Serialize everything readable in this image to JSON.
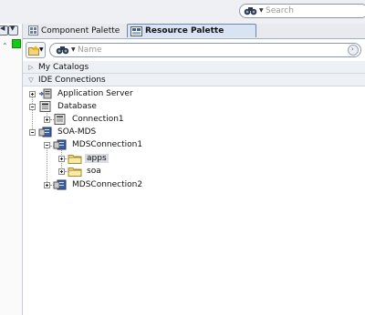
{
  "header": {
    "search_placeholder": "Search"
  },
  "tabs": [
    {
      "label": "Component Palette",
      "active": false
    },
    {
      "label": "Resource Palette",
      "active": true
    }
  ],
  "toolbar": {
    "name_placeholder": "Name"
  },
  "sections": {
    "my_catalogs": "My Catalogs",
    "ide_connections": "IDE Connections"
  },
  "tree": [
    {
      "label": "Application Server",
      "icon": "app-server-icon",
      "expanded": false
    },
    {
      "label": "Database",
      "icon": "database-icon",
      "expanded": true
    },
    {
      "label": "Connection1",
      "icon": "db-connection-icon",
      "expanded": false
    },
    {
      "label": "SOA-MDS",
      "icon": "mds-icon",
      "expanded": true
    },
    {
      "label": "MDSConnection1",
      "icon": "mds-connection-icon",
      "expanded": true
    },
    {
      "label": "apps",
      "icon": "folder-icon",
      "expanded": false,
      "selected": true
    },
    {
      "label": "soa",
      "icon": "folder-icon",
      "expanded": false
    },
    {
      "label": "MDSConnection2",
      "icon": "mds-connection-icon",
      "expanded": false
    }
  ],
  "colors": {
    "active_tab": "#d8e3f3",
    "section_bg": "#edf0f4",
    "status_green": "#14c814",
    "selection": "#d9dce2"
  }
}
